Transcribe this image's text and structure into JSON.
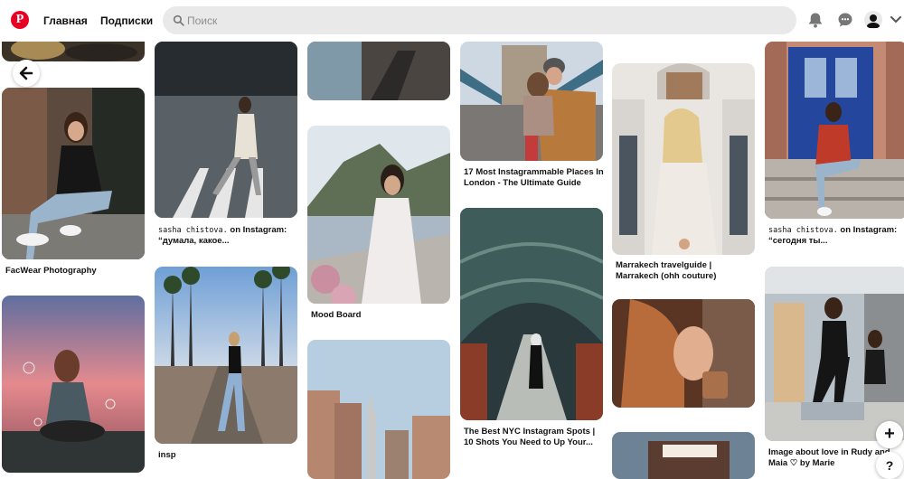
{
  "header": {
    "logo": "P",
    "nav": [
      "Главная",
      "Подписки"
    ],
    "search_placeholder": "Поиск",
    "icons": [
      "bell-icon",
      "chat-icon",
      "avatar",
      "chevron-down-icon"
    ]
  },
  "pins": [
    {
      "caption": "FacWear Photography"
    },
    {
      "caption_user": "sasha chistova.",
      "caption_rest": " on Instagram: “думала, какое..."
    },
    {
      "caption": "insp"
    },
    {
      "caption": "Mood Board"
    },
    {
      "caption": "17 Most Instagrammable Places In London - The Ultimate Guide"
    },
    {
      "caption": "The Best NYC Instagram Spots | 10 Shots You Need to Up Your..."
    },
    {
      "caption": "Marrakech travelguide | Marrakech (ohh couture)"
    },
    {
      "caption_user": "sasha chistova.",
      "caption_rest": " on Instagram: “сегодня ты..."
    },
    {
      "caption": "Image about love in Rudy and Maia ♡ by Marie"
    }
  ],
  "fab": {
    "plus": "+",
    "help": "?"
  },
  "colors": {
    "brand": "#e60023",
    "search_bg": "#e9e9e9"
  }
}
